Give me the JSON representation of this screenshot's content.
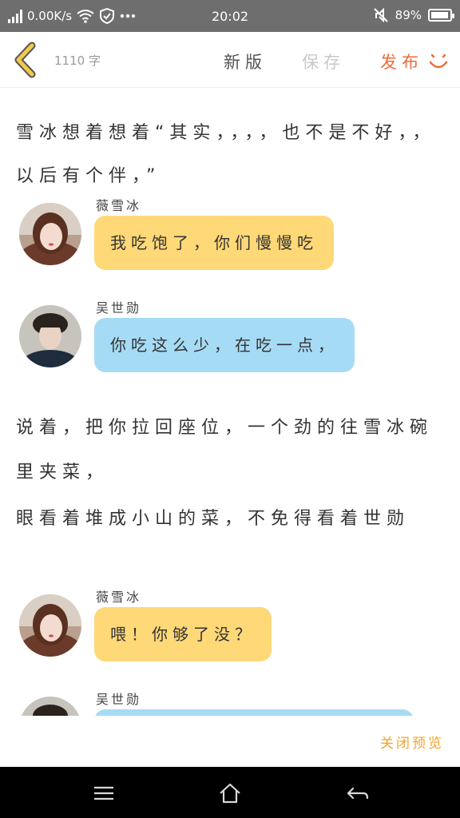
{
  "status": {
    "network_speed": "0.00K/s",
    "time": "20:02",
    "battery_percent": "89%",
    "battery_level": 0.89
  },
  "toolbar": {
    "word_count": "1110 字",
    "new_version": "新版",
    "save": "保存",
    "publish": "发布"
  },
  "content": {
    "paragraphs": [
      "雪冰想着想着“其实，，，，也不是不好，，以后有个伴，”",
      "说着，把你拉回座位，一个劲的往雪冰碗里夹菜，",
      "眼看着堆成小山的菜，不免得看着世勋"
    ],
    "messages": [
      {
        "name": "薇雪冰",
        "text": "我吃饱了，你们慢慢吃",
        "color": "#ffd877"
      },
      {
        "name": "吴世勋",
        "text": "你吃这么少，在吃一点，",
        "color": "#a6dbf5"
      },
      {
        "name": "薇雪冰",
        "text": "喂！你够了没？",
        "color": "#ffd877"
      },
      {
        "name": "吴世勋",
        "text": "",
        "color": "#a6dbf5"
      }
    ]
  },
  "footer": {
    "close_preview": "关闭预览"
  },
  "colors": {
    "accent_publish": "#f06a3a",
    "accent_close": "#f3a42b",
    "back_arrow": "#f2c94c"
  }
}
